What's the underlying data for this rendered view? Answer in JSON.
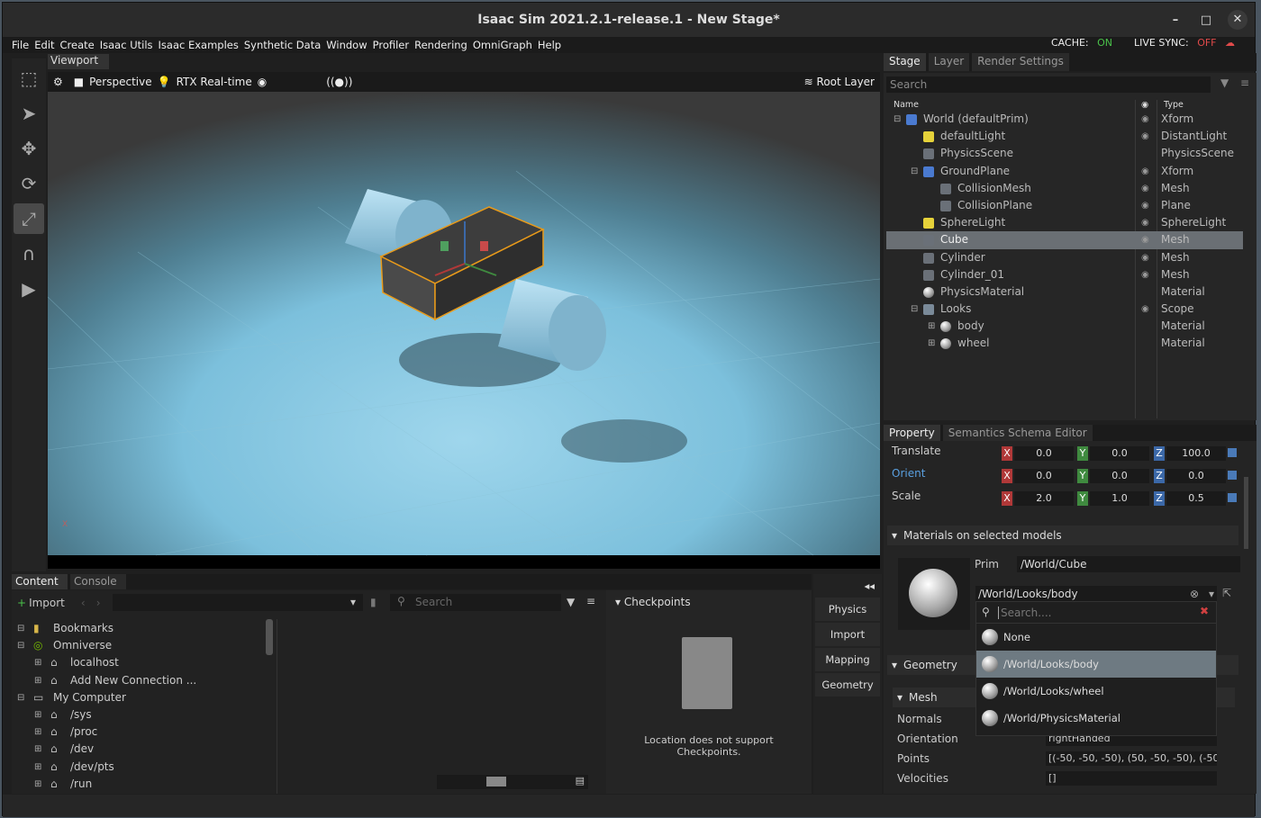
{
  "window": {
    "title": "Isaac Sim 2021.2.1-release.1 - New Stage*",
    "min": "–",
    "max": "□",
    "close": "✕"
  },
  "menu": [
    "File",
    "Edit",
    "Create",
    "Isaac Utils",
    "Isaac Examples",
    "Synthetic Data",
    "Window",
    "Profiler",
    "Rendering",
    "OmniGraph",
    "Help"
  ],
  "cache": {
    "label": "CACHE:",
    "value": "ON"
  },
  "live_sync": {
    "label": "LIVE SYNC:",
    "value": "OFF"
  },
  "viewport": {
    "tab": "Viewport",
    "camera": "Perspective",
    "renderer": "RTX Real-time",
    "layer": "Root Layer"
  },
  "stage": {
    "tabs": [
      "Stage",
      "Layer",
      "Render Settings"
    ],
    "search": "Search",
    "col_name": "Name",
    "col_type": "Type",
    "rows": [
      {
        "name": "World (defaultPrim)",
        "type": "Xform",
        "indent": 0,
        "exp": "−",
        "icon": "xform",
        "eye": true,
        "sel": false
      },
      {
        "name": "defaultLight",
        "type": "DistantLight",
        "indent": 1,
        "exp": "",
        "icon": "light",
        "eye": true,
        "sel": false
      },
      {
        "name": "PhysicsScene",
        "type": "PhysicsScene",
        "indent": 1,
        "exp": "",
        "icon": "cube",
        "eye": false,
        "sel": false
      },
      {
        "name": "GroundPlane",
        "type": "Xform",
        "indent": 1,
        "exp": "−",
        "icon": "xform",
        "eye": true,
        "sel": false
      },
      {
        "name": "CollisionMesh",
        "type": "Mesh",
        "indent": 2,
        "exp": "",
        "icon": "cube",
        "eye": true,
        "sel": false
      },
      {
        "name": "CollisionPlane",
        "type": "Plane",
        "indent": 2,
        "exp": "",
        "icon": "cube",
        "eye": true,
        "sel": false
      },
      {
        "name": "SphereLight",
        "type": "SphereLight",
        "indent": 1,
        "exp": "",
        "icon": "light",
        "eye": true,
        "sel": false
      },
      {
        "name": "Cube",
        "type": "Mesh",
        "indent": 1,
        "exp": "",
        "icon": "cube",
        "eye": true,
        "sel": true
      },
      {
        "name": "Cylinder",
        "type": "Mesh",
        "indent": 1,
        "exp": "",
        "icon": "cube",
        "eye": true,
        "sel": false
      },
      {
        "name": "Cylinder_01",
        "type": "Mesh",
        "indent": 1,
        "exp": "",
        "icon": "cube",
        "eye": true,
        "sel": false
      },
      {
        "name": "PhysicsMaterial",
        "type": "Material",
        "indent": 1,
        "exp": "",
        "icon": "mat",
        "eye": false,
        "sel": false
      },
      {
        "name": "Looks",
        "type": "Scope",
        "indent": 1,
        "exp": "−",
        "icon": "folder",
        "eye": true,
        "sel": false
      },
      {
        "name": "body",
        "type": "Material",
        "indent": 2,
        "exp": "+",
        "icon": "mat",
        "eye": false,
        "sel": false
      },
      {
        "name": "wheel",
        "type": "Material",
        "indent": 2,
        "exp": "+",
        "icon": "mat",
        "eye": false,
        "sel": false
      }
    ]
  },
  "property": {
    "tabs": [
      "Property",
      "Semantics Schema Editor"
    ],
    "transforms": [
      {
        "label": "Translate",
        "x": "0.0",
        "y": "0.0",
        "z": "100.0"
      },
      {
        "label": "Orient",
        "x": "0.0",
        "y": "0.0",
        "z": "0.0"
      },
      {
        "label": "Scale",
        "x": "2.0",
        "y": "1.0",
        "z": "0.5"
      }
    ],
    "materials_title": "Materials on selected models",
    "prim_label": "Prim",
    "prim_value": "/World/Cube",
    "material_value": "/World/Looks/body",
    "search_placeholder": "Search....",
    "dropdown": [
      "None",
      "/World/Looks/body",
      "/World/Looks/wheel",
      "/World/PhysicsMaterial"
    ],
    "geometry_title": "Geometry",
    "mesh_title": "Mesh",
    "mesh_rows": [
      {
        "label": "Normals",
        "value": ""
      },
      {
        "label": "Orientation",
        "value": "rightHanded"
      },
      {
        "label": "Points",
        "value": "[(-50, -50, -50), (50, -50, -50), (-50, -5"
      },
      {
        "label": "Velocities",
        "value": "[]"
      }
    ]
  },
  "content": {
    "tabs": [
      "Content",
      "Console"
    ],
    "import": "Import",
    "search": "Search",
    "tree": [
      {
        "label": "Bookmarks",
        "indent": 0,
        "exp": "−",
        "icon": "bookmark"
      },
      {
        "label": "Omniverse",
        "indent": 0,
        "exp": "−",
        "icon": "omni"
      },
      {
        "label": "localhost",
        "indent": 1,
        "exp": "+",
        "icon": "drive"
      },
      {
        "label": "Add New Connection ...",
        "indent": 1,
        "exp": "+",
        "icon": "drive"
      },
      {
        "label": "My Computer",
        "indent": 0,
        "exp": "−",
        "icon": "pc"
      },
      {
        "label": "/sys",
        "indent": 1,
        "exp": "+",
        "icon": "drive"
      },
      {
        "label": "/proc",
        "indent": 1,
        "exp": "+",
        "icon": "drive"
      },
      {
        "label": "/dev",
        "indent": 1,
        "exp": "+",
        "icon": "drive"
      },
      {
        "label": "/dev/pts",
        "indent": 1,
        "exp": "+",
        "icon": "drive"
      },
      {
        "label": "/run",
        "indent": 1,
        "exp": "+",
        "icon": "drive"
      }
    ],
    "checkpoints_title": "Checkpoints",
    "checkpoints_msg": "Location does not support Checkpoints."
  },
  "side_buttons": [
    "Physics",
    "Import",
    "Mapping",
    "Geometry"
  ]
}
